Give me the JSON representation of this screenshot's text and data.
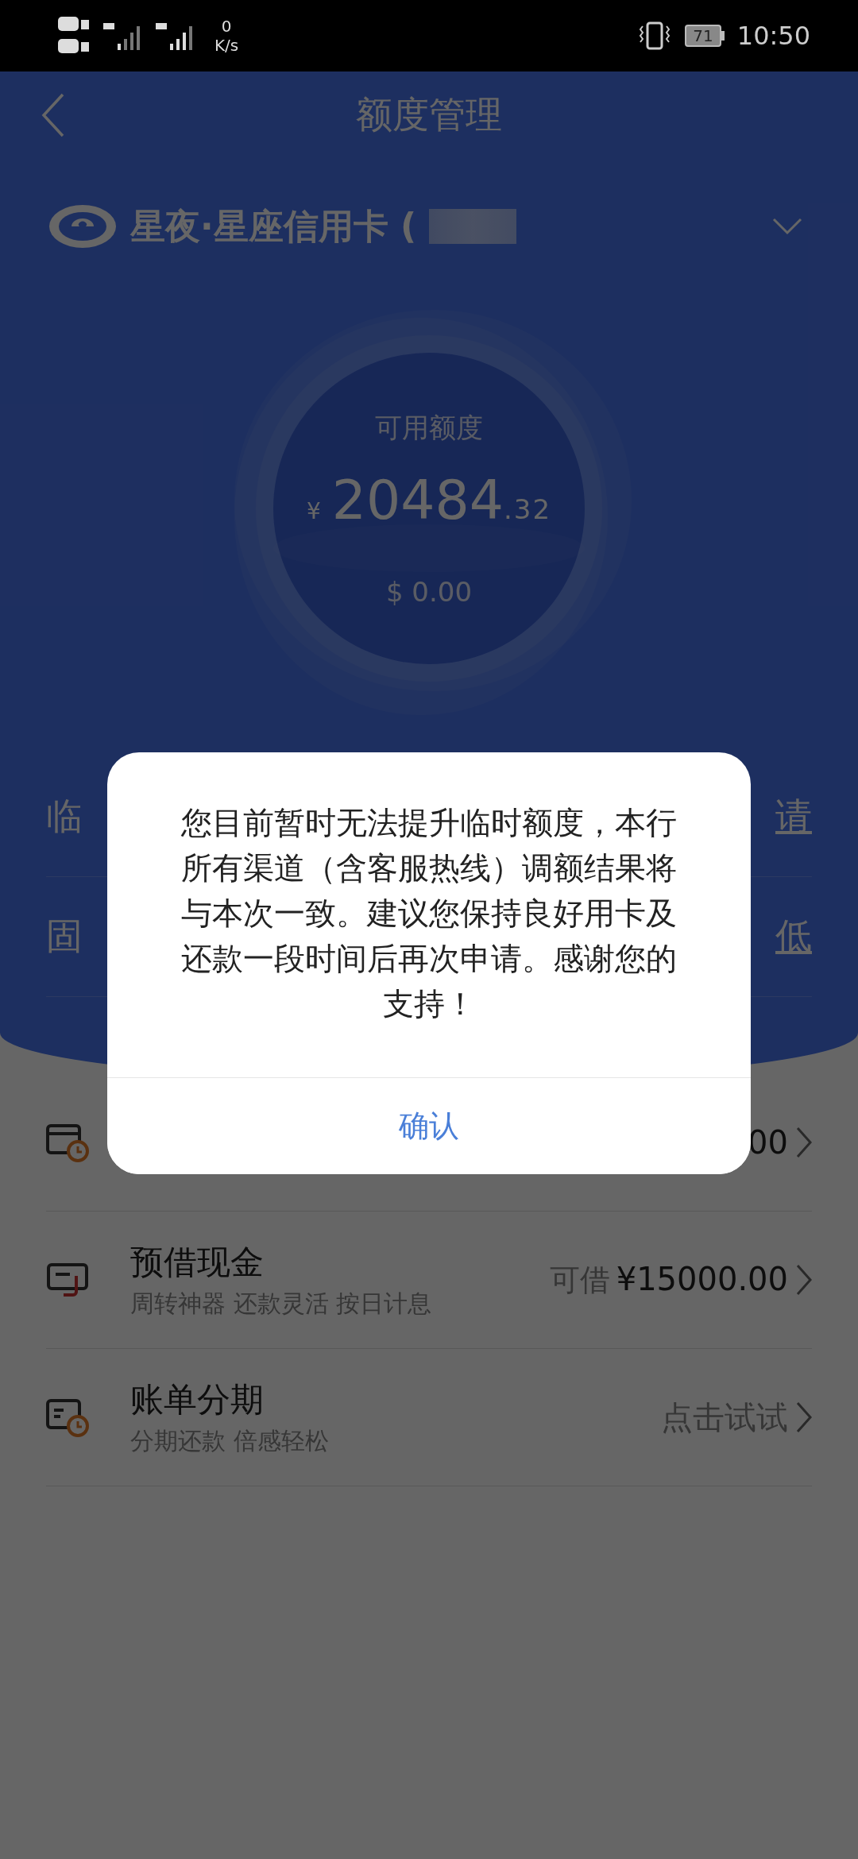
{
  "status_bar": {
    "speed_value": "0",
    "speed_unit": "K/s",
    "battery": "71",
    "time": "10:50"
  },
  "header": {
    "title": "额度管理"
  },
  "card": {
    "name": "星夜·星座信用卡 ("
  },
  "balance": {
    "label": "可用额度",
    "currency": "¥",
    "integer": "20484",
    "decimal": ".32",
    "usd": "$ 0.00"
  },
  "limit_rows": [
    {
      "label": "临",
      "action": "请"
    },
    {
      "label": "固",
      "action": "低"
    }
  ],
  "services": [
    {
      "kind": "card-clock",
      "value": "00",
      "highlight": true
    },
    {
      "kind": "cash",
      "title": "预借现金",
      "subtitle": "周转神器 还款灵活 按日计息",
      "value_prefix": "可借",
      "value": "¥15000.00",
      "highlight": true
    },
    {
      "kind": "bill-clock",
      "title": "账单分期",
      "subtitle": "分期还款 倍感轻松",
      "value": "点击试试",
      "highlight": false
    }
  ],
  "dialog": {
    "message": "您目前暂时无法提升临时额度，本行所有渠道（含客服热线）调额结果将与本次一致。建议您保持良好用卡及还款一段时间后再次申请。感谢您的支持！",
    "confirm": "确认"
  }
}
